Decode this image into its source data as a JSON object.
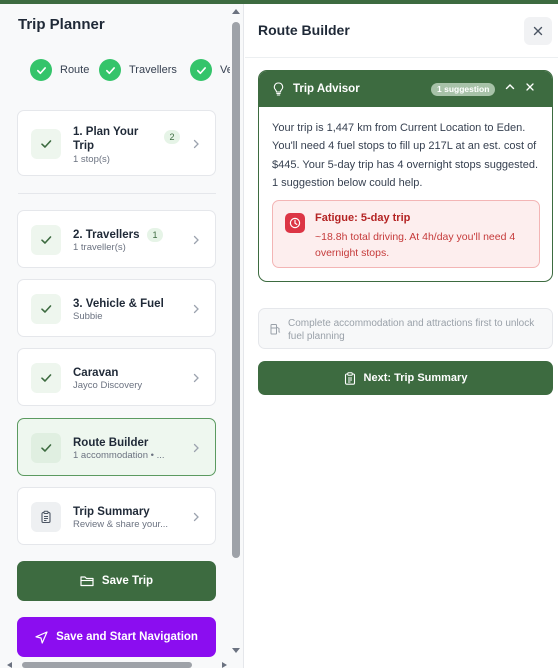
{
  "sidebar": {
    "title": "Trip Planner",
    "progress_steps": [
      {
        "label": "Route"
      },
      {
        "label": "Travellers"
      },
      {
        "label": "Ve"
      }
    ],
    "cards": [
      {
        "title": "1. Plan Your Trip",
        "subtitle": "1 stop(s)",
        "badge": "2"
      },
      {
        "title": "2. Travellers",
        "subtitle": "1 traveller(s)",
        "badge": "1"
      },
      {
        "title": "3. Vehicle & Fuel",
        "subtitle": "Subbie"
      },
      {
        "title": "Caravan",
        "subtitle": "Jayco Discovery"
      },
      {
        "title": "Route Builder",
        "subtitle": "1 accommodation • ..."
      },
      {
        "title": "Trip Summary",
        "subtitle": "Review & share your..."
      }
    ],
    "save_label": "Save Trip",
    "navigate_label": "Save and Start Navigation"
  },
  "panel": {
    "title": "Route Builder",
    "advisor": {
      "title": "Trip Advisor",
      "badge": "1 suggestion",
      "body": "Your trip is 1,447 km from Current Location to Eden. You'll need 4 fuel stops to fill up 217L at an est. cost of $445. Your 5-day trip has 4 overnight stops suggested. 1 suggestion below could help.",
      "alert": {
        "title": "Fatigue: 5-day trip",
        "text": "~18.8h total driving. At 4h/day you'll need 4 overnight stops."
      }
    },
    "locked_text": "Complete accommodation and attractions first to unlock fuel planning",
    "next_label": "Next: Trip Summary"
  },
  "colors": {
    "primary": "#3d6b40",
    "success": "#34c46a",
    "danger": "#dc3545",
    "navigate": "#8b0df0"
  }
}
